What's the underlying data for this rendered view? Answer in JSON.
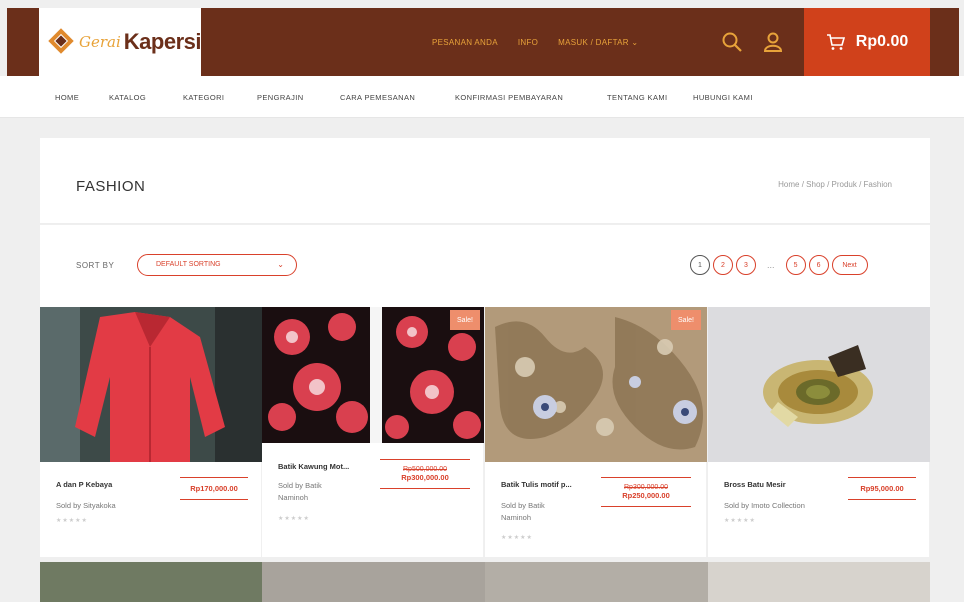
{
  "brand": {
    "script": "Gerai",
    "word": "Kapersi"
  },
  "top_links": [
    "PESANAN ANDA",
    "INFO",
    "MASUK / DAFTAR"
  ],
  "cart": {
    "amount": "Rp0.00"
  },
  "nav": [
    "HOME",
    "KATALOG",
    "KATEGORI",
    "PENGRAJIN",
    "CARA PEMESANAN",
    "KONFIRMASI PEMBAYARAN",
    "TENTANG KAMI",
    "HUBUNGI KAMI"
  ],
  "page": {
    "title": "FASHION",
    "breadcrumb": "Home / Shop / Produk / Fashion"
  },
  "sort": {
    "label": "SORT BY",
    "selected": "DEFAULT SORTING"
  },
  "pagination": {
    "pages": [
      "1",
      "2",
      "3",
      "5",
      "6"
    ],
    "dots": "...",
    "next": "Next",
    "current": "1"
  },
  "products": [
    {
      "name": "A dan P Kebaya",
      "sold_by": "Sold by Sityakoka",
      "price": "Rp170,000.00",
      "old_price": "",
      "sale": ""
    },
    {
      "name": "Batik Kawung Mot...",
      "sold_by": "Sold by Batik Naminoh",
      "price": "Rp300,000.00",
      "old_price": "Rp500,000.00",
      "sale": "Sale!"
    },
    {
      "name": "Batik Tulis motif p...",
      "sold_by": "Sold by Batik Naminoh",
      "price": "Rp250,000.00",
      "old_price": "Rp300,000.00",
      "sale": "Sale!"
    },
    {
      "name": "Bross Batu Mesir",
      "sold_by": "Sold by Imoto Collection",
      "price": "Rp95,000.00",
      "old_price": "",
      "sale": ""
    }
  ],
  "stars": "★★★★★",
  "colors": {
    "brand_brown": "#6b2f1a",
    "accent_red": "#d0411b",
    "gold": "#e8a33a"
  }
}
